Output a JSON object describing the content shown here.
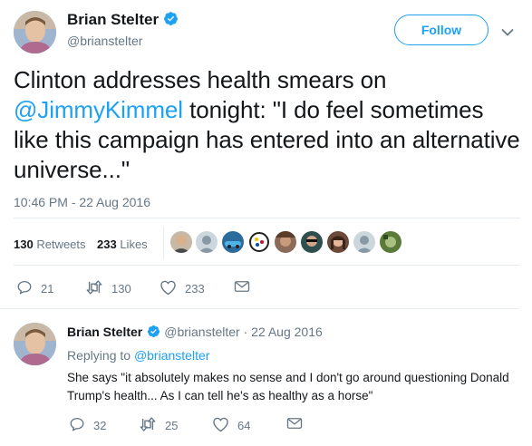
{
  "tweet": {
    "author_name": "Brian Stelter",
    "author_handle": "@brianstelter",
    "follow_label": "Follow",
    "text_before": "Clinton addresses health smears on ",
    "mention": "@JimmyKimmel",
    "text_after": " tonight: \"I do feel sometimes like this campaign has entered into an alternative universe...\"",
    "timestamp": "10:46 PM - 22 Aug 2016",
    "retweets_count": "130",
    "retweets_label": "Retweets",
    "likes_count": "233",
    "likes_label": "Likes",
    "actions": {
      "reply_count": "21",
      "retweet_count": "130",
      "like_count": "233"
    }
  },
  "reply": {
    "author_name": "Brian Stelter",
    "meta": "@brianstelter · 22 Aug 2016",
    "replying_label": "Replying to",
    "replying_handle": "@brianstelter",
    "text": "She says \"it absolutely makes no sense and I don't go around questioning Donald Trump's health... As I can tell he's as healthy as a horse\"",
    "actions": {
      "reply_count": "32",
      "retweet_count": "25",
      "like_count": "64"
    }
  },
  "colors": {
    "accent": "#1da1f2",
    "muted": "#657786",
    "text": "#14171a",
    "divider": "#e6ecf0"
  },
  "icons": [
    "verified-badge-icon",
    "chevron-down-icon",
    "reply-icon",
    "retweet-icon",
    "like-heart-icon",
    "direct-message-icon"
  ]
}
